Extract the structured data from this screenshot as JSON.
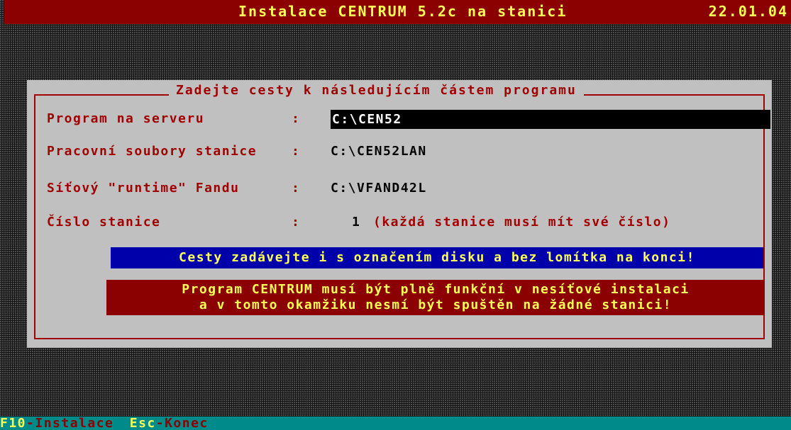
{
  "titlebar": {
    "title": "Instalace CENTRUM 5.2c na stanici",
    "date": "22.01.04"
  },
  "dialog": {
    "frame_title": "Zadejte cesty k následujícím částem programu",
    "fields": [
      {
        "label": "Program na serveru",
        "colon": ":",
        "value": "C:\\CEN52",
        "active": true
      },
      {
        "label": "Pracovní soubory stanice",
        "colon": ":",
        "value": "C:\\CEN52LAN"
      },
      {
        "label": "Síťový \"runtime\" Fandu",
        "colon": ":",
        "value": "C:\\VFAND42L"
      },
      {
        "label": "Číslo stanice",
        "colon": ":",
        "value": "1",
        "hint": "(každá stanice musí mít své číslo)"
      }
    ],
    "notice_blue": "Cesty zadávejte i s označením disku a bez lomítka na konci!",
    "notice_red_line1": "Program CENTRUM musí být plně funkční v nesíťové instalaci",
    "notice_red_line2": "a v tomto okamžiku nesmí být spuštěn na žádné stanici!"
  },
  "bottombar": {
    "f10_key": "F10",
    "f10_label": "-Instalace",
    "esc_key": "Esc",
    "esc_label": "-Konec"
  },
  "colors": {
    "title_bg": "#8b0000",
    "highlight_text": "#ffff55",
    "dialog_bg": "#c0c0c0",
    "label_text": "#a00000",
    "notice_blue_bg": "#0000aa",
    "bottom_bg": "#008b8b"
  }
}
